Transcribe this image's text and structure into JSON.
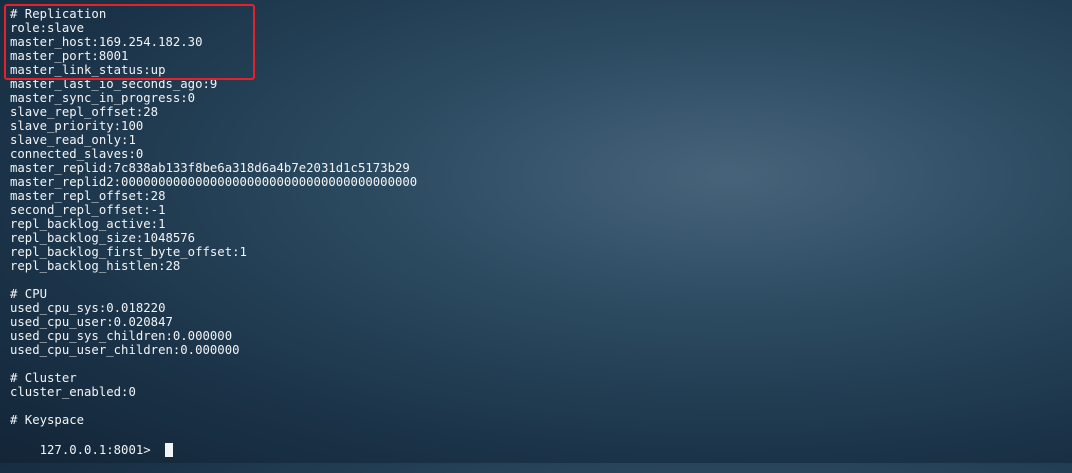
{
  "terminal": {
    "lines": [
      "# Replication",
      "role:slave",
      "master_host:169.254.182.30",
      "master_port:8001",
      "master_link_status:up",
      "master_last_io_seconds_ago:9",
      "master_sync_in_progress:0",
      "slave_repl_offset:28",
      "slave_priority:100",
      "slave_read_only:1",
      "connected_slaves:0",
      "master_replid:7c838ab133f8be6a318d6a4b7e2031d1c5173b29",
      "master_replid2:0000000000000000000000000000000000000000",
      "master_repl_offset:28",
      "second_repl_offset:-1",
      "repl_backlog_active:1",
      "repl_backlog_size:1048576",
      "repl_backlog_first_byte_offset:1",
      "repl_backlog_histlen:28",
      "",
      "# CPU",
      "used_cpu_sys:0.018220",
      "used_cpu_user:0.020847",
      "used_cpu_sys_children:0.000000",
      "used_cpu_user_children:0.000000",
      "",
      "# Cluster",
      "cluster_enabled:0",
      "",
      "# Keyspace"
    ],
    "prompt": "127.0.0.1:8001>"
  },
  "colors": {
    "text": "#f2f4f6",
    "highlight_border": "#e8202a",
    "background": "#1b3348"
  }
}
